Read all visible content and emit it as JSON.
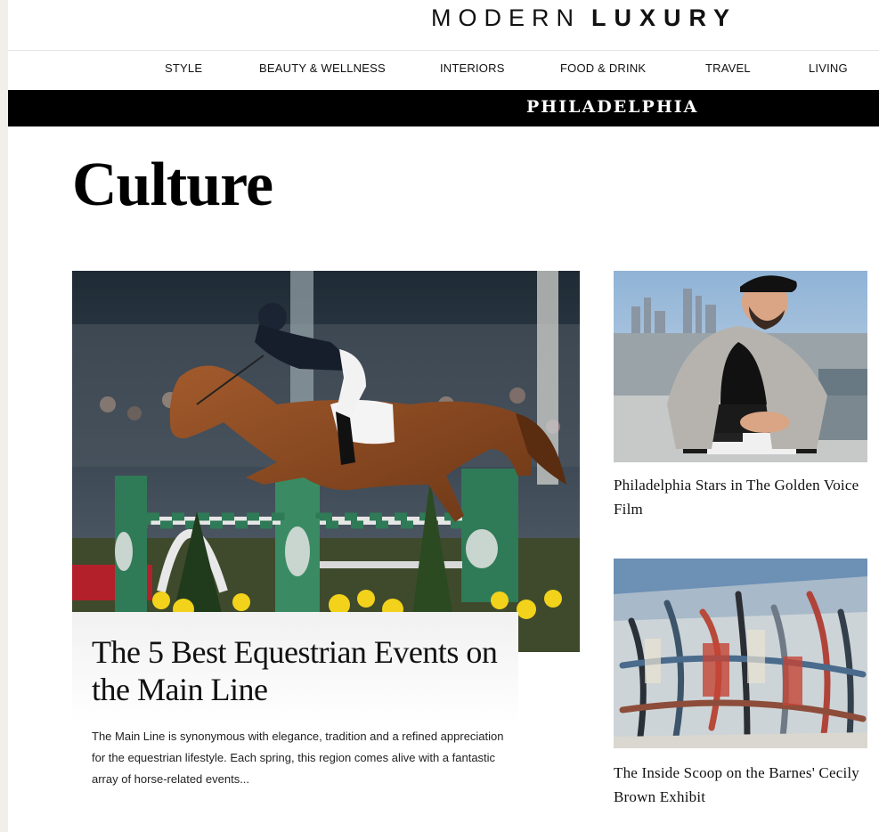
{
  "brand": {
    "light": "MODERN",
    "bold": "LUXURY"
  },
  "nav": [
    "STYLE",
    "BEAUTY & WELLNESS",
    "INTERIORS",
    "FOOD & DRINK",
    "TRAVEL",
    "LIVING"
  ],
  "region": "PHILADELPHIA",
  "page_title": "Culture",
  "hero": {
    "title": "The 5 Best Equestrian Events on the Main Line",
    "excerpt": "The Main Line is synonymous with elegance, tradition and a refined appreciation for the equestrian lifestyle. Each spring, this region comes alive with a fantastic array of horse-related events..."
  },
  "side_articles": [
    {
      "title": "Philadelphia Stars in The Golden Voice Film"
    },
    {
      "title": "The Inside Scoop on the Barnes' Cecily Brown Exhibit"
    }
  ],
  "colors": {
    "region_bg": "#000000",
    "horse": "#8a4a22",
    "jump_green": "#2f7a57"
  }
}
